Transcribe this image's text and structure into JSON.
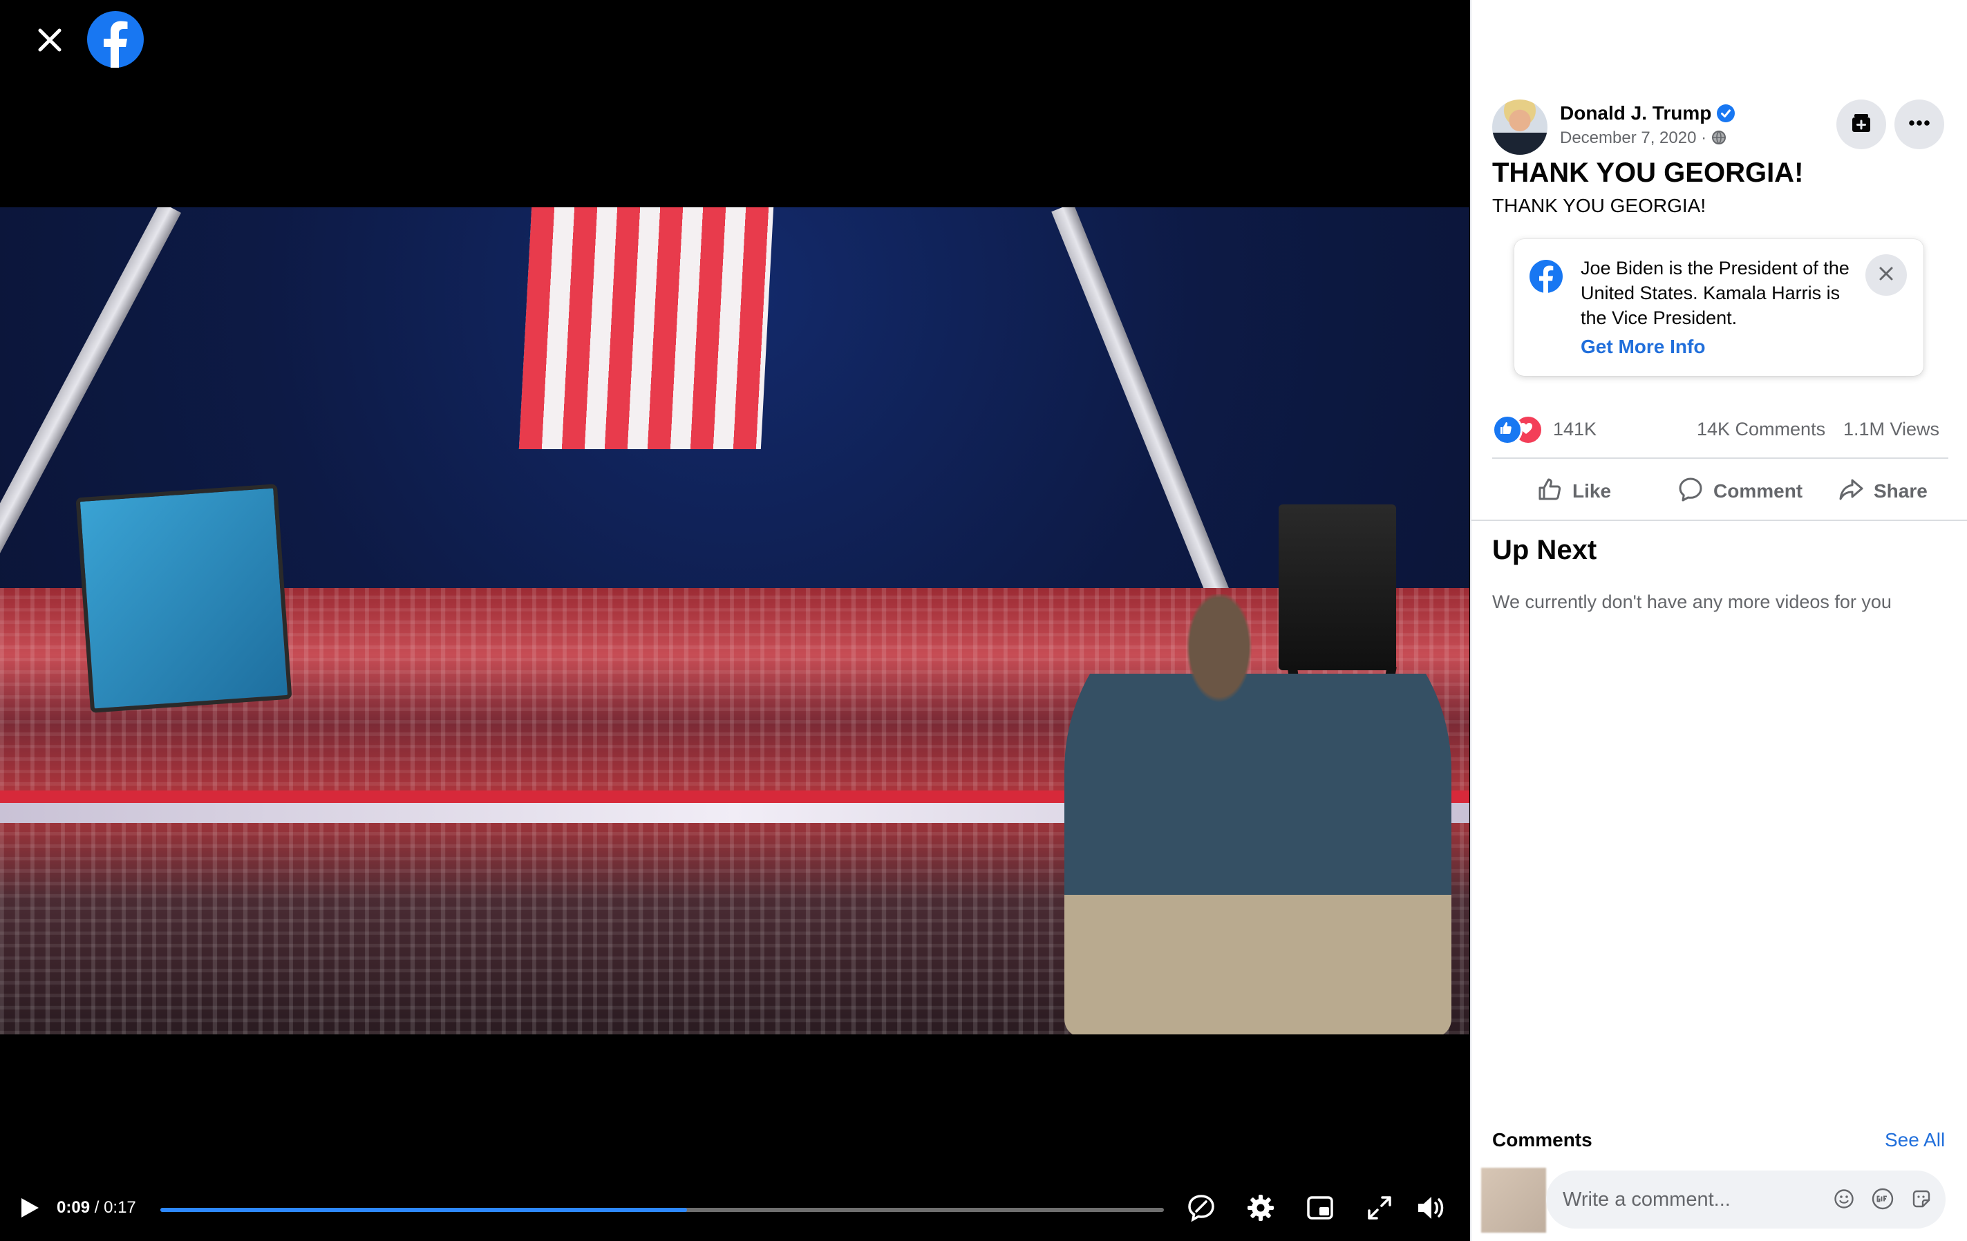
{
  "viewer": {
    "player": {
      "current_time": "0:09",
      "separator": " / ",
      "duration": "0:17",
      "progress": 0.525
    }
  },
  "sidebar": {
    "post": {
      "author": "Donald J. Trump",
      "date": "December 7, 2020 · ",
      "title": "THANK YOU GEORGIA!",
      "text": "THANK YOU GEORGIA!"
    },
    "info_card": {
      "text": "Joe Biden is the President of the United States. Kamala Harris is the Vice President.",
      "link": "Get More Info"
    },
    "stats": {
      "reactions": "141K",
      "comments": "14K Comments",
      "views": "1.1M Views"
    },
    "actions": {
      "like": "Like",
      "comment": "Comment",
      "share": "Share"
    },
    "up_next": {
      "title": "Up Next",
      "empty": "We currently don't have any more videos for you"
    },
    "comments": {
      "label": "Comments",
      "see_all": "See All",
      "placeholder": "Write a comment..."
    }
  },
  "colors": {
    "accent": "#1877f2",
    "link": "#216fdb",
    "love": "#f33e58",
    "muted_text": "#65676b"
  },
  "icons": [
    "close-icon",
    "facebook-logo-icon",
    "play-icon",
    "captions-icon",
    "gear-icon",
    "miniplayer-icon",
    "fullscreen-icon",
    "volume-icon",
    "menu-grid-icon",
    "messenger-icon",
    "bell-icon",
    "caret-down-icon",
    "verified-badge-icon",
    "globe-icon",
    "save-icon",
    "more-icon",
    "like-icon",
    "comment-icon",
    "share-icon",
    "emoji-icon",
    "gif-icon",
    "sticker-icon"
  ]
}
